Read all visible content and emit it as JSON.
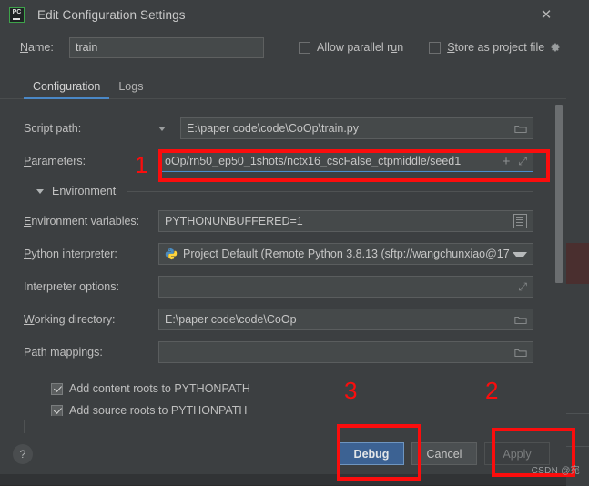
{
  "window": {
    "title": "Edit Configuration Settings",
    "app_icon": "pycharm-icon",
    "app_icon_text": "PC",
    "close_icon": "✕"
  },
  "name_row": {
    "label_prefix": "N",
    "label_rest": "ame:",
    "value": "train",
    "placeholder": "",
    "allow_parallel_run": {
      "label_prefix": "",
      "label_a": "Allow parallel r",
      "label_u": "u",
      "label_b": "n",
      "checked": false
    },
    "store_as_project_file": {
      "label_s": "S",
      "label_rest": "tore as project file",
      "checked": false,
      "gear_icon": "gear-icon"
    }
  },
  "tabs": [
    {
      "label": "Configuration",
      "active": true
    },
    {
      "label": "Logs",
      "active": false
    }
  ],
  "form": {
    "script_path": {
      "label": "Script path:",
      "value": "E:\\paper code\\code\\CoOp\\train.py",
      "has_dropdown": true,
      "trail_icon": "folder-icon"
    },
    "parameters": {
      "label_p": "P",
      "label_rest": "arameters:",
      "value": "oOp/rn50_ep50_1shots/nctx16_cscFalse_ctpmiddle/seed1",
      "trail_icons": [
        "plus-icon",
        "expand-icon"
      ],
      "focused": true
    },
    "environment_group": {
      "title": "Environment",
      "expanded": true
    },
    "env_variables": {
      "label_e": "E",
      "label_rest": "nvironment variables:",
      "value": "PYTHONUNBUFFERED=1",
      "trail_icon": "list-editor-icon"
    },
    "python_interpreter": {
      "label_p": "P",
      "label_rest": "ython interpreter:",
      "value": "Project Default (Remote Python 3.8.13 (sftp://wangchunxiao@17",
      "icon": "python-icon"
    },
    "interpreter_options": {
      "label": "Interpreter options:",
      "value": "",
      "trail_icon": "expand-icon"
    },
    "working_directory": {
      "label_w": "W",
      "label_rest": "orking directory:",
      "value": "E:\\paper code\\code\\CoOp",
      "trail_icon": "folder-icon"
    },
    "path_mappings": {
      "label": "Path mappings:",
      "value": "",
      "trail_icon": "folder-icon"
    },
    "add_content_roots": {
      "label": "Add content roots to PYTHONPATH",
      "checked": true
    },
    "add_source_roots": {
      "label": "Add source roots to PYTHONPATH",
      "checked": true
    }
  },
  "bottom": {
    "help_label": "?",
    "debug_label": "Debug",
    "cancel_label": "Cancel",
    "apply_label": "Apply"
  },
  "annotations": {
    "one": "1",
    "two": "2",
    "three": "3"
  },
  "watermark": "CSDN @宛",
  "colors": {
    "dialog_bg": "#3c3f41",
    "field_bg": "#45494a",
    "accent_blue": "#4a88c7",
    "primary_button": "#3c6293",
    "annotation_red": "#fb0d0d",
    "pycharm_green": "#3ea34a"
  }
}
